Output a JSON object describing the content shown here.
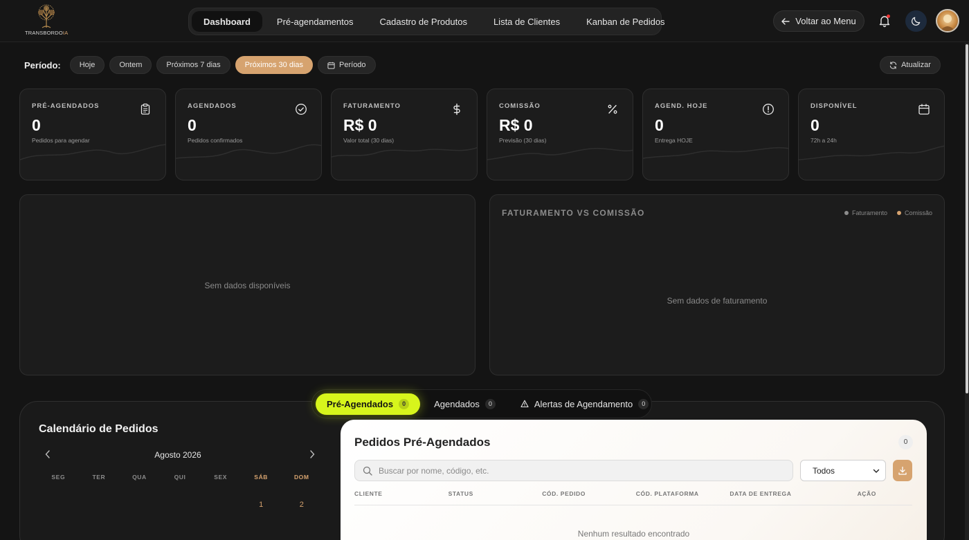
{
  "header": {
    "logo_text": "TRANSBORDO",
    "logo_accent": "IA",
    "nav": [
      {
        "label": "Dashboard",
        "active": true
      },
      {
        "label": "Pré-agendamentos"
      },
      {
        "label": "Cadastro de Produtos"
      },
      {
        "label": "Lista de Clientes"
      },
      {
        "label": "Kanban de Pedidos"
      }
    ],
    "back_label": "Voltar ao Menu"
  },
  "period": {
    "label": "Período:",
    "options": [
      "Hoje",
      "Ontem",
      "Próximos 7 dias",
      "Próximos 30 dias",
      "Período"
    ],
    "active": "Próximos 30 dias",
    "refresh_label": "Atualizar"
  },
  "cards": [
    {
      "label": "PRÉ-AGENDADOS",
      "value": "0",
      "sub": "Pedidos para agendar",
      "icon": "clipboard-icon"
    },
    {
      "label": "AGENDADOS",
      "value": "0",
      "sub": "Pedidos confirmados",
      "icon": "check-circle-icon"
    },
    {
      "label": "FATURAMENTO",
      "value": "R$ 0",
      "sub": "Valor total (30 dias)",
      "icon": "dollar-icon"
    },
    {
      "label": "COMISSÃO",
      "value": "R$ 0",
      "sub": "Previsão (30 dias)",
      "icon": "percent-icon"
    },
    {
      "label": "AGEND. HOJE",
      "value": "0",
      "sub": "Entrega HOJE",
      "icon": "alert-circle-icon"
    },
    {
      "label": "DISPONÍVEL",
      "value": "0",
      "sub": "72h a 24h",
      "icon": "calendar-icon"
    }
  ],
  "panels": {
    "left_empty": "Sem dados disponíveis",
    "right_title": "FATURAMENTO VS COMISSÃO",
    "right_legend": [
      "Faturamento",
      "Comissão"
    ],
    "right_empty": "Sem dados de faturamento"
  },
  "calendar": {
    "title": "Calendário de Pedidos",
    "month": "Agosto 2026",
    "weekdays": [
      "SEG",
      "TER",
      "QUA",
      "QUI",
      "SEX",
      "SÁB",
      "DOM"
    ],
    "first_days": [
      "",
      "",
      "",
      "",
      "",
      "1",
      "2"
    ]
  },
  "tabs": [
    {
      "label": "Pré-Agendados",
      "count": "0",
      "active": true
    },
    {
      "label": "Agendados",
      "count": "0"
    },
    {
      "label": "Alertas de Agendamento",
      "count": "0"
    }
  ],
  "orders": {
    "title": "Pedidos Pré-Agendados",
    "count": "0",
    "search_placeholder": "Buscar por nome, código, etc.",
    "filter_value": "Todos",
    "columns": [
      "CLIENTE",
      "STATUS",
      "CÓD. PEDIDO",
      "CÓD. PLATAFORMA",
      "DATA DE ENTREGA",
      "AÇÃO"
    ],
    "empty": "Nenhum resultado encontrado"
  },
  "colors": {
    "accent": "#d6a36f",
    "tab_active": "#d7f51c",
    "background": "#141414"
  }
}
